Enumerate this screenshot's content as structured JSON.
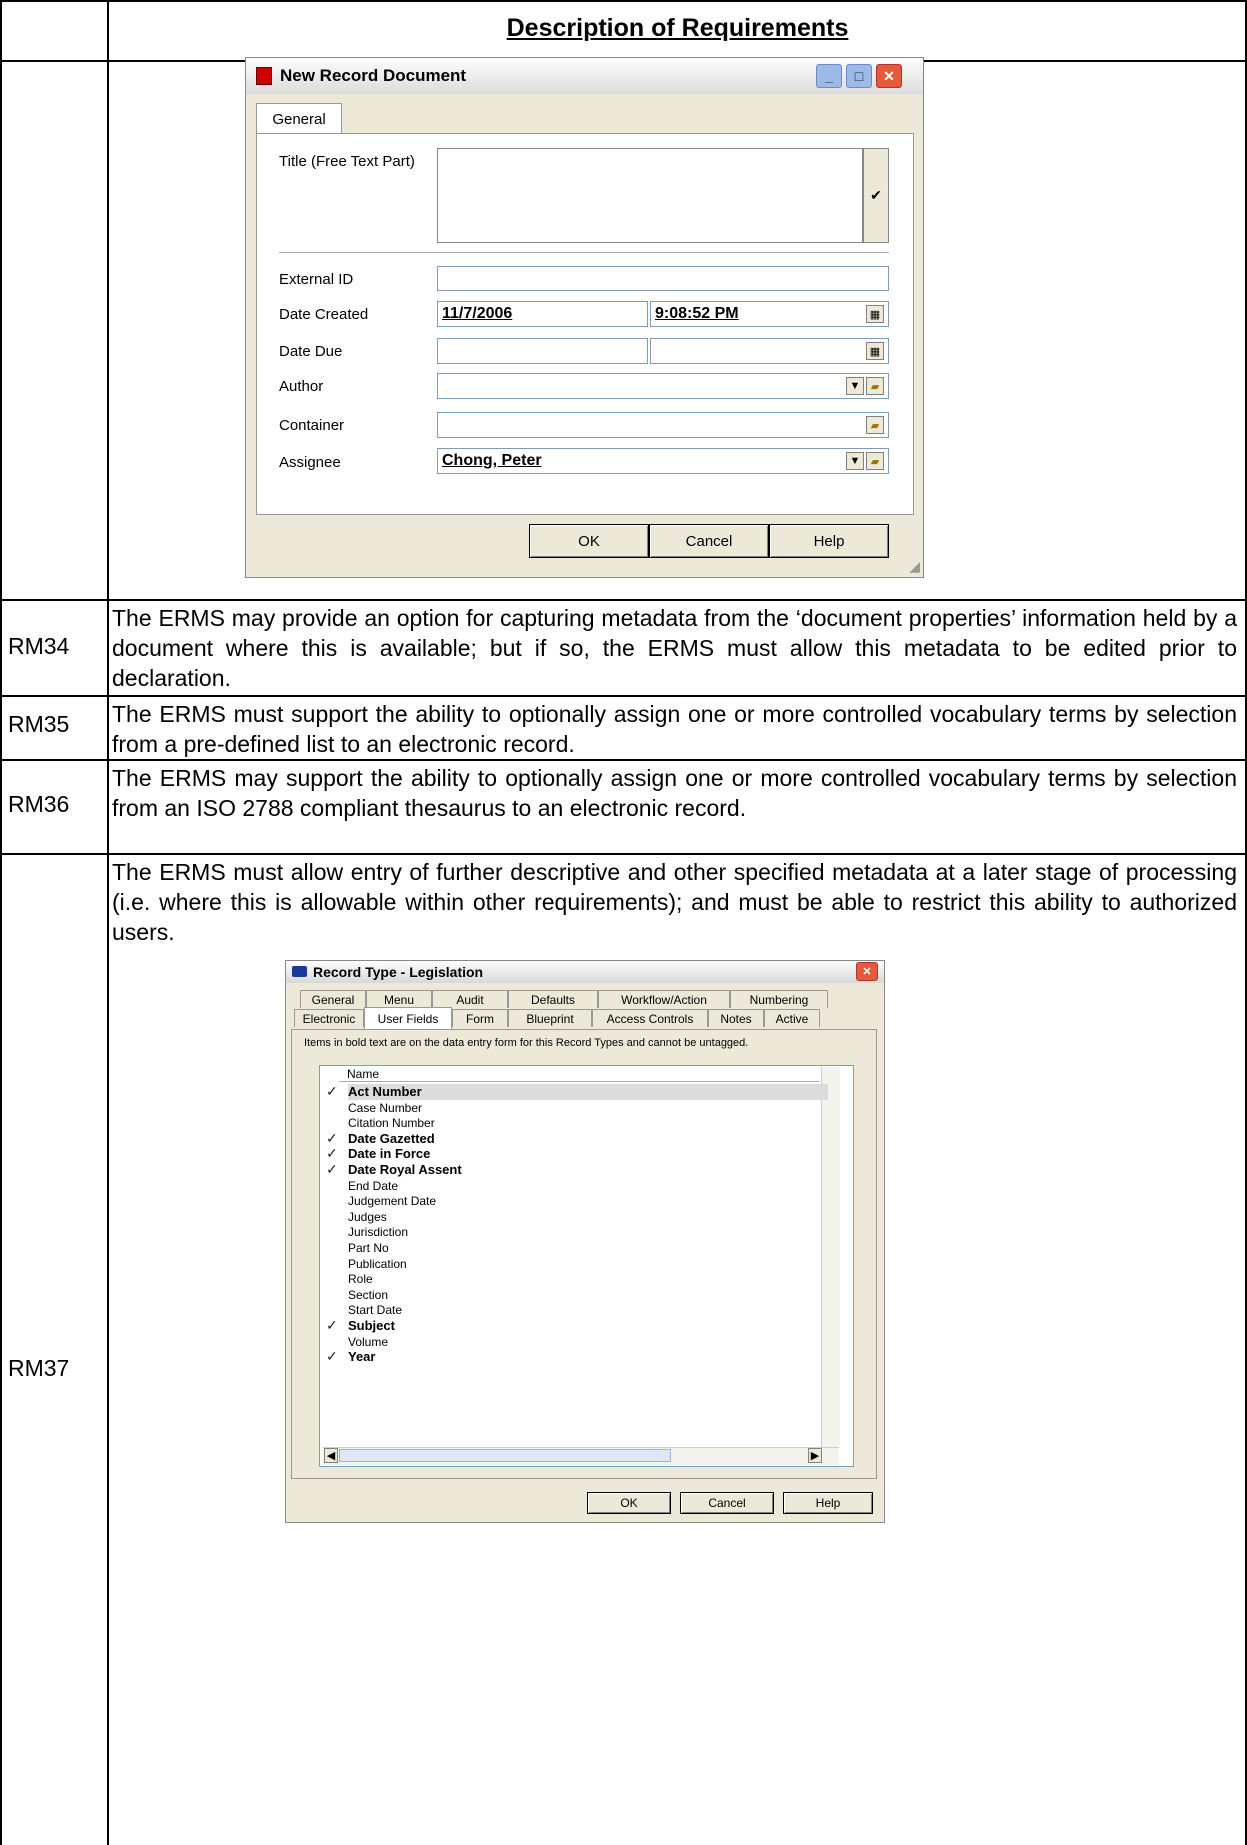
{
  "header": {
    "title": "Description of Requirements"
  },
  "window1": {
    "title": "New Record Document",
    "tab": "General",
    "fields": {
      "title_label": "Title (Free Text Part)",
      "external_id_label": "External ID",
      "date_created_label": "Date Created",
      "date_created_date": "11/7/2006",
      "date_created_time": "9:08:52 PM",
      "date_due_label": "Date Due",
      "author_label": "Author",
      "container_label": "Container",
      "assignee_label": "Assignee",
      "assignee_value": "Chong, Peter"
    },
    "buttons": {
      "ok": "OK",
      "cancel": "Cancel",
      "help": "Help"
    }
  },
  "rows": [
    {
      "id": "RM34",
      "text": "The ERMS may provide an option for capturing metadata from the ‘document properties’ information held by a document where this is available; but if so, the ERMS must allow this metadata to be edited prior to declaration."
    },
    {
      "id": "RM35",
      "text": "The ERMS must support the ability to optionally assign one or more controlled vocabulary terms by selection from a pre-defined list to an electronic record."
    },
    {
      "id": "RM36",
      "text": "The ERMS may support the ability to optionally assign one or more controlled vocabulary terms by selection from an ISO 2788 compliant thesaurus to an electronic record."
    },
    {
      "id": "RM37",
      "text": "The ERMS must allow entry of further descriptive and other specified metadata at a later stage of processing (i.e. where this is allowable within other requirements); and must be able to restrict this ability to authorized users."
    }
  ],
  "window2": {
    "title": "Record Type - Legislation",
    "tabs_row1": [
      "General",
      "Menu",
      "Audit",
      "Defaults",
      "Workflow/Action",
      "Numbering"
    ],
    "tabs_row2": [
      "Electronic",
      "User Fields",
      "Form",
      "Blueprint",
      "Access Controls",
      "Notes",
      "Active"
    ],
    "info": "Items in bold text are on the data entry form for this Record Types and cannot be untagged.",
    "column_header": "Name",
    "items": [
      {
        "name": "Act Number",
        "bold": true
      },
      {
        "name": "Case Number",
        "bold": false
      },
      {
        "name": "Citation Number",
        "bold": false
      },
      {
        "name": "Date Gazetted",
        "bold": true
      },
      {
        "name": "Date in Force",
        "bold": true
      },
      {
        "name": "Date Royal Assent",
        "bold": true
      },
      {
        "name": "End Date",
        "bold": false
      },
      {
        "name": "Judgement Date",
        "bold": false
      },
      {
        "name": "Judges",
        "bold": false
      },
      {
        "name": "Jurisdiction",
        "bold": false
      },
      {
        "name": "Part No",
        "bold": false
      },
      {
        "name": "Publication",
        "bold": false
      },
      {
        "name": "Role",
        "bold": false
      },
      {
        "name": "Section",
        "bold": false
      },
      {
        "name": "Start Date",
        "bold": false
      },
      {
        "name": "Subject",
        "bold": true
      },
      {
        "name": "Volume",
        "bold": false
      },
      {
        "name": "Year",
        "bold": true
      }
    ],
    "buttons": {
      "ok": "OK",
      "cancel": "Cancel",
      "help": "Help"
    }
  }
}
